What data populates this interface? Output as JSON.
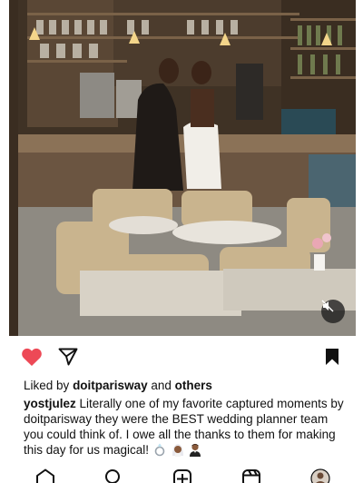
{
  "post": {
    "liked_by_prefix": "Liked by",
    "liked_by_user": "doitparisway",
    "liked_by_and": "and",
    "liked_by_others": "others",
    "caption_user": "yostjulez",
    "caption_text": "Literally one of my favorite captured moments by doitparisway they were the BEST wedding planner team you could think of. I owe all the thanks to them for making this day for us magical!",
    "caption_emojis": [
      "ring",
      "bride-with-veil",
      "man-in-tuxedo"
    ]
  },
  "icons": {
    "like": "heart-filled-icon",
    "share": "paper-plane-icon",
    "save": "bookmark-filled-icon",
    "mute": "speaker-muted-icon",
    "nav": [
      "home-icon",
      "search-icon",
      "create-icon",
      "reels-icon",
      "profile-avatar"
    ]
  },
  "colors": {
    "like_red": "#ed4956",
    "text": "#111111",
    "mute_bg": "#1e1e1e"
  }
}
